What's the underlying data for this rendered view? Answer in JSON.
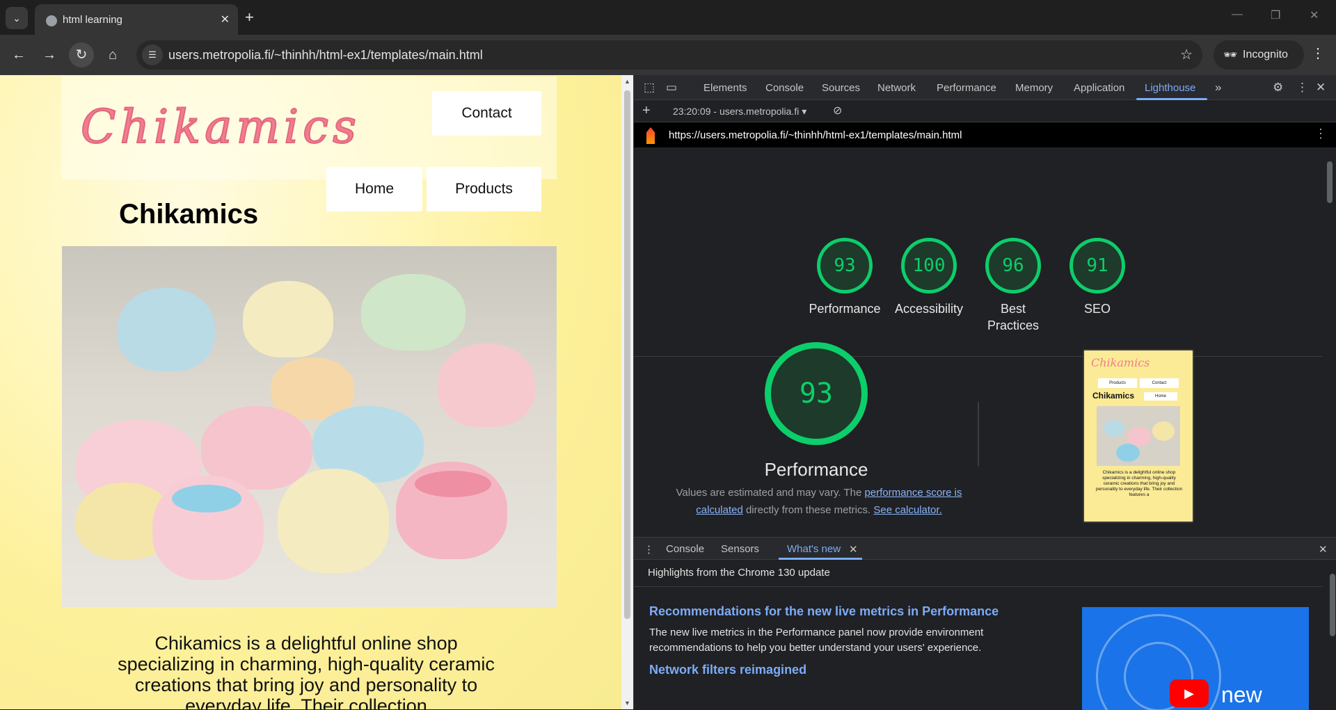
{
  "browser": {
    "tab_title": "html learning",
    "url": "users.metropolia.fi/~thinhh/html-ex1/templates/main.html",
    "incognito_label": "Incognito"
  },
  "page": {
    "logo_text": "Chikamics",
    "nav": {
      "contact": "Contact",
      "home": "Home",
      "products": "Products"
    },
    "title": "Chikamics",
    "description": "Chikamics is a delightful online shop specializing in charming, high-quality ceramic creations that bring joy and personality to everyday life. Their collection"
  },
  "devtools": {
    "tabs": [
      "Elements",
      "Console",
      "Sources",
      "Network",
      "Performance",
      "Memory",
      "Application",
      "Lighthouse"
    ],
    "active_tab": "Lighthouse",
    "report_selector": "23:20:09 - users.metropolia.fi",
    "report_url": "https://users.metropolia.fi/~thinhh/html-ex1/templates/main.html",
    "scores": [
      {
        "label": "Performance",
        "value": 93
      },
      {
        "label": "Accessibility",
        "value": 100
      },
      {
        "label": "Best Practices",
        "value": 96
      },
      {
        "label": "SEO",
        "value": 91
      }
    ],
    "main_gauge": {
      "value": "93",
      "title": "Performance"
    },
    "note": {
      "prefix": "Values are estimated and may vary. The ",
      "link1": "performance score is calculated",
      "middle": " directly from these metrics. ",
      "link2": "See calculator."
    },
    "thumbnail": {
      "logo": "Chikamics",
      "nav_products": "Products",
      "nav_contact": "Contact",
      "title": "Chikamics",
      "nav_home": "Home",
      "text": "Chikamics is a delightful online shop specializing in charming, high-quality ceramic creations that bring joy and personality to everyday life. Their collection features a"
    },
    "drawer": {
      "tabs": [
        "Console",
        "Sensors",
        "What's new"
      ],
      "active_tab": "What's new",
      "highlights": "Highlights from the Chrome 130 update",
      "item1_title": "Recommendations for the new live metrics in Performance",
      "item1_text": "The new live metrics in the Performance panel now provide environment recommendations to help you better understand your users' experience.",
      "item2_title": "Network filters reimagined",
      "video_label": "new"
    }
  },
  "colors": {
    "accent": "#7cacf8",
    "score_good": "#0cce6b",
    "page_bg": "#fdf09a",
    "logo_pink": "#f27c8f"
  }
}
